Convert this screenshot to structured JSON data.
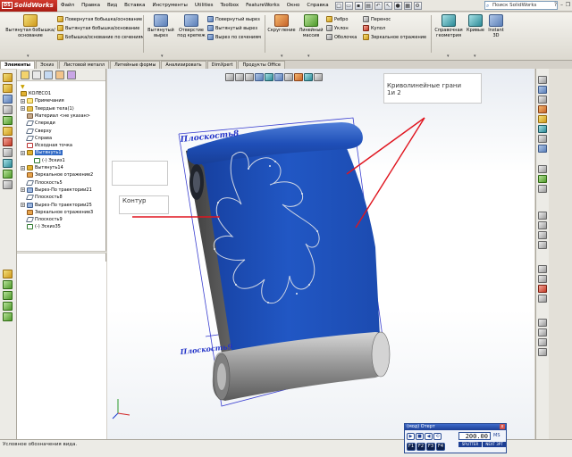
{
  "app": {
    "name": "SolidWorks",
    "logo_prefix": "DS"
  },
  "menu": {
    "items": [
      "Файл",
      "Правка",
      "Вид",
      "Вставка",
      "Инструменты",
      "Utilities",
      "Toolbox",
      "FeatureWorks",
      "Окно",
      "Справка"
    ]
  },
  "search": {
    "placeholder": "Поиск SolidWorks"
  },
  "command_manager": {
    "extruded_boss": "Вытянутая бобышка/основание",
    "revolved_boss": "Повернутая бобышка/основание",
    "swept_boss": "Вытянутая бобышка/основание",
    "lofted_boss": "Бобышка/основание по сечениям",
    "extruded_cut": "Вытянутый вырез",
    "hole_wizard": "Отверстие под крепеж",
    "revolved_cut": "Повернутый вырез",
    "swept_cut": "Вытянутый вырез",
    "lofted_cut": "Вырез по сечениям",
    "fillet": "Скругление",
    "linear_pattern": "Линейный массив",
    "rib": "Ребро",
    "draft": "Уклон",
    "shell": "Оболочка",
    "wrap": "Перенос",
    "dome": "Купол",
    "mirror": "Зеркальное отражение",
    "reference_geometry": "Справочная геометрия",
    "curves": "Кривые",
    "instant3d": "Instant 3D"
  },
  "tabs": [
    "Элементы",
    "Эскиз",
    "Листовой металл",
    "Литейные формы",
    "Анализировать",
    "DimXpert",
    "Продукты Office"
  ],
  "feature_tree": {
    "root": "КОЛЕСО1",
    "items": [
      {
        "label": "Примечания",
        "icon": "note",
        "expandable": true
      },
      {
        "label": "Твердые тела(1)",
        "icon": "folder",
        "expandable": true
      },
      {
        "label": "Материал <не указан>",
        "icon": "mat",
        "expandable": false
      },
      {
        "label": "Спереди",
        "icon": "plane",
        "expandable": false
      },
      {
        "label": "Сверху",
        "icon": "plane",
        "expandable": false
      },
      {
        "label": "Справа",
        "icon": "plane",
        "expandable": false
      },
      {
        "label": "Исходная точка",
        "icon": "origin",
        "expandable": false
      },
      {
        "label": "Вытянуть1",
        "icon": "feat",
        "expandable": true,
        "selected": true
      },
      {
        "label": "(-) Эскиз1",
        "icon": "sketch",
        "expandable": false,
        "indent": 1
      },
      {
        "label": "Вытянуть14",
        "icon": "feat",
        "expandable": true
      },
      {
        "label": "Зеркальное отражение2",
        "icon": "mirror",
        "expandable": false
      },
      {
        "label": "Плоскость5",
        "icon": "plane",
        "expandable": false
      },
      {
        "label": "Вырез-По траектории21",
        "icon": "cut",
        "expandable": true
      },
      {
        "label": "Плоскость8",
        "icon": "plane",
        "expandable": false
      },
      {
        "label": "Вырез-По траектории25",
        "icon": "cut",
        "expandable": true
      },
      {
        "label": "Зеркальное отражение3",
        "icon": "mirror",
        "expandable": false
      },
      {
        "label": "Плоскость9",
        "icon": "plane",
        "expandable": false
      },
      {
        "label": "(-) Эскиз35",
        "icon": "sketch",
        "expandable": false
      }
    ]
  },
  "graphics": {
    "plane_top": "Плоскость8",
    "plane_bottom": "Плоскость9",
    "callout_contour": "Контур",
    "callout_faces": "Криволинейные грани\n1и 2",
    "colors": {
      "face_blue": "#1f4fb8",
      "annotation_red": "#e0141e",
      "plane_label": "#2233c8"
    }
  },
  "status": {
    "text": "Условное обозначения вида."
  },
  "timer": {
    "title": "(мод) Отерт",
    "close": "x",
    "value": "200.00",
    "unit": "MS",
    "mode1": "SPLITTER",
    "mode2": "NEXT 3PT",
    "fkeys": [
      "F1",
      "F2",
      "F3",
      "F4"
    ],
    "controls": [
      "▶",
      "■",
      "◀",
      "⟲"
    ]
  }
}
